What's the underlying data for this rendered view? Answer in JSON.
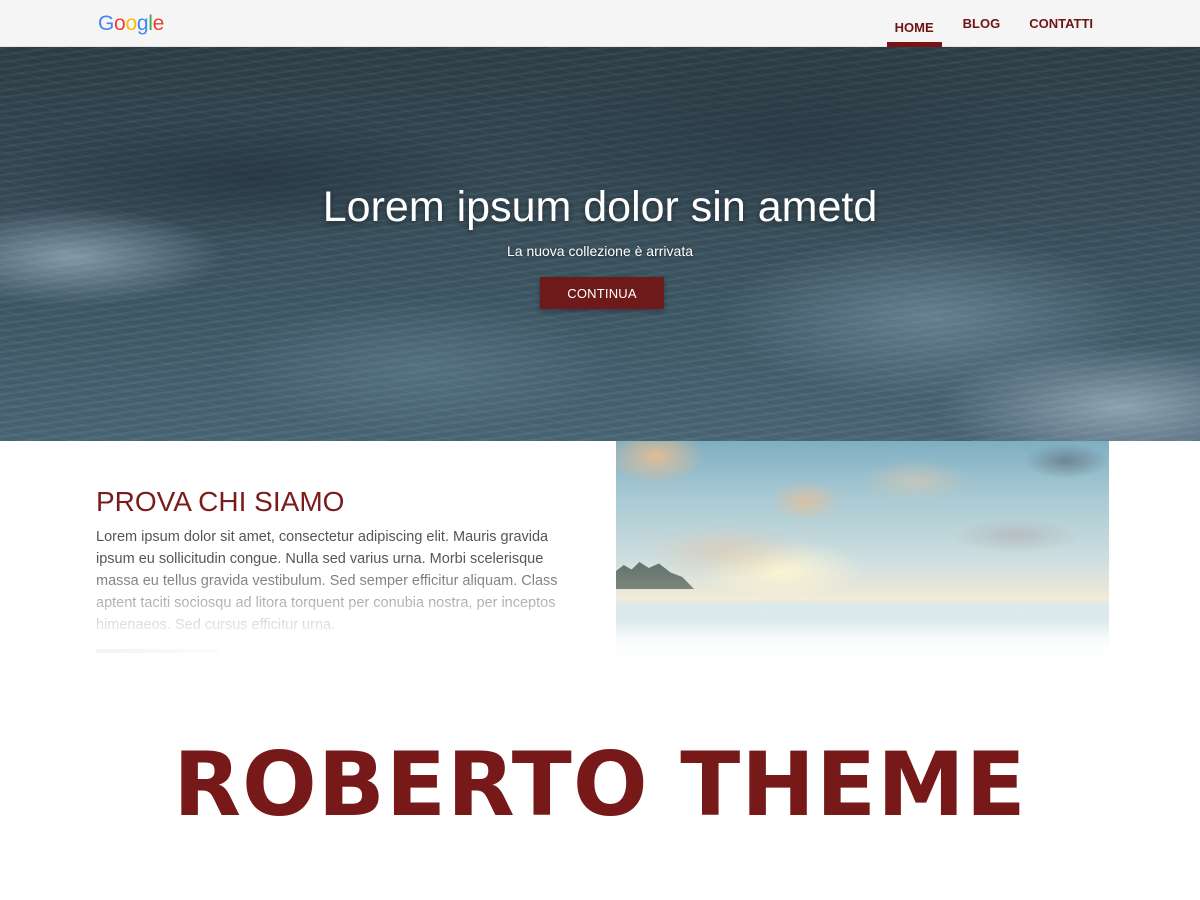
{
  "header": {
    "logo_letters": [
      {
        "char": "G",
        "color": "#4285F4"
      },
      {
        "char": "o",
        "color": "#EA4335"
      },
      {
        "char": "o",
        "color": "#FBBC05"
      },
      {
        "char": "g",
        "color": "#4285F4"
      },
      {
        "char": "l",
        "color": "#34A853"
      },
      {
        "char": "e",
        "color": "#EA4335"
      }
    ],
    "nav": [
      {
        "label": "HOME",
        "active": true
      },
      {
        "label": "BLOG",
        "active": false
      },
      {
        "label": "CONTATTI",
        "active": false
      }
    ]
  },
  "hero": {
    "title": "Lorem ipsum dolor sin ametd",
    "subtitle": "La nuova collezione è arrivata",
    "button_label": "CONTINUA"
  },
  "about": {
    "title": "PROVA CHI SIAMO",
    "text": "Lorem ipsum dolor sit amet, consectetur adipiscing elit. Mauris gravida ipsum eu sollicitudin congue. Nulla sed varius urna. Morbi scelerisque massa eu tellus gravida vestibulum. Sed semper efficitur aliquam. Class aptent taciti sociosqu ad litora torquent per conubia nostra, per inceptos himenaeos. Sed cursus efficitur urna."
  },
  "banner": {
    "text": "ROBERTO THEME"
  },
  "colors": {
    "brand": "#771919",
    "header_bg": "#f5f5f5",
    "nav_text": "#6e1414"
  }
}
